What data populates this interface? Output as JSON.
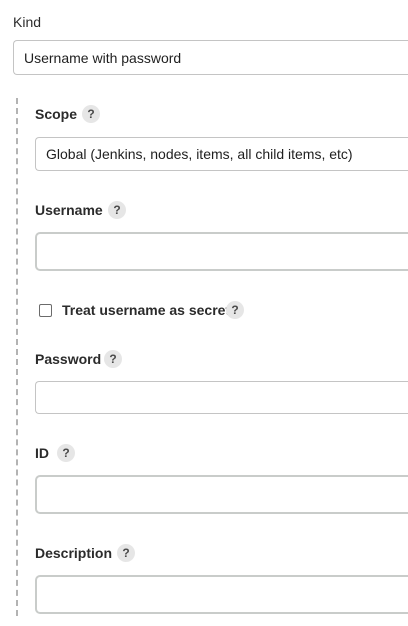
{
  "kind": {
    "label": "Kind",
    "selected": "Username with password"
  },
  "scope": {
    "label": "Scope",
    "help": "?",
    "selected": "Global (Jenkins, nodes, items, all child items, etc)"
  },
  "username": {
    "label": "Username",
    "help": "?",
    "value": ""
  },
  "treat_secret": {
    "label": "Treat username as secret",
    "help": "?",
    "checked": false
  },
  "password": {
    "label": "Password",
    "help": "?",
    "value": ""
  },
  "id": {
    "label": "ID",
    "help": "?",
    "value": ""
  },
  "description": {
    "label": "Description",
    "help": "?",
    "value": ""
  }
}
